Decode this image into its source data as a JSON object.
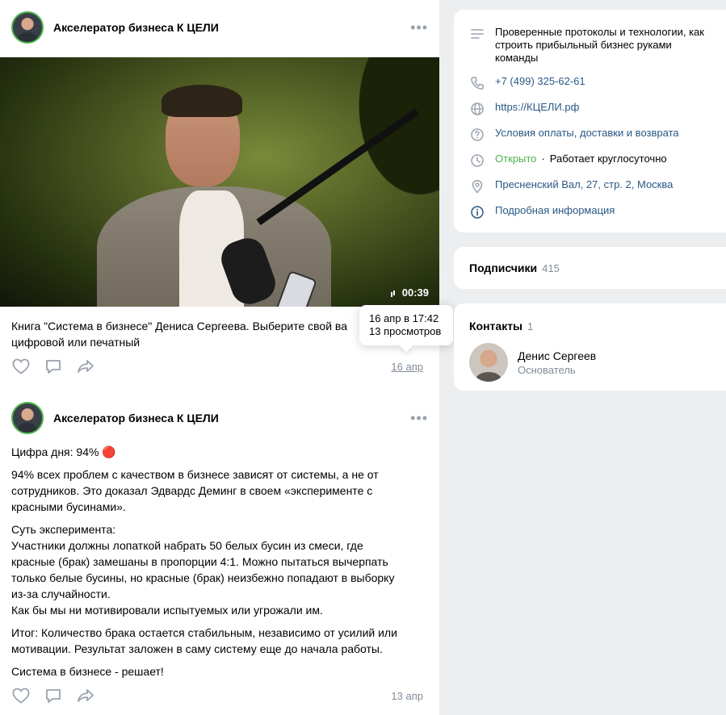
{
  "posts": [
    {
      "author": "Акселератор бизнеса К ЦЕЛИ",
      "video_duration": "00:39",
      "text": "Книга \"Система в бизнесе\" Дениса Сергеева. Выберите свой ва",
      "text_line2": "цифровой или печатный",
      "date": "16 апр",
      "tooltip": {
        "datetime": "16 апр в 17:42",
        "views": "13 просмотров"
      }
    },
    {
      "author": "Акселератор бизнеса К ЦЕЛИ",
      "paragraphs": [
        "Цифра дня: 94% 🔴",
        "94% всех проблем с качеством в бизнесе зависят от системы, а не от\nсотрудников. Это доказал Эдвардс Деминг в своем «эксперименте с\nкрасными бусинами».",
        "Суть эксперимента:\nУчастники должны лопаткой набрать 50 белых бусин из смеси, где\nкрасные (брак) замешаны в пропорции 4:1. Можно пытаться вычерпать\nтолько белые бусины, но красные (брак) неизбежно попадают в выборку\nиз-за случайности.\nКак бы мы ни мотивировали испытуемых или угрожали им.",
        "Итог: Количество брака остается стабильным, независимо от усилий или\nмотивации. Результат заложен в саму систему еще до начала работы.",
        "Система в бизнесе - решает!"
      ],
      "date": "13 апр"
    }
  ],
  "info": {
    "description": "Проверенные протоколы и технологии, как строить прибыльный бизнес руками команды",
    "phone": "+7 (499) 325-62-61",
    "website": "https://КЦЕЛИ.рф",
    "terms": "Условия оплаты, доставки и возврата",
    "status_open": "Открыто",
    "status_hours": "Работает круглосуточно",
    "address": "Пресненский Вал, 27, стр. 2, Москва",
    "more": "Подробная информация"
  },
  "subscribers": {
    "title": "Подписчики",
    "count": "415"
  },
  "contacts": {
    "title": "Контакты",
    "count": "1",
    "items": [
      {
        "name": "Денис Сергеев",
        "role": "Основатель"
      }
    ]
  },
  "colors": {
    "link": "#2a5885",
    "open": "#4bb34b",
    "muted": "#818c99",
    "background": "#edeef0"
  }
}
